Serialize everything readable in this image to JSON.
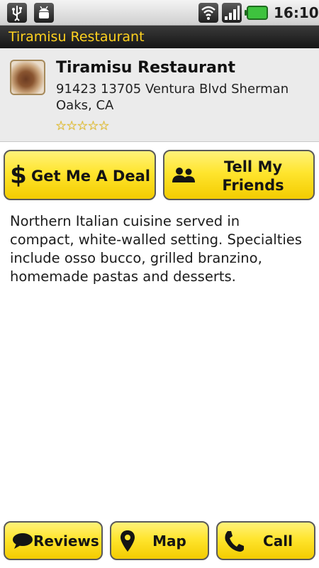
{
  "status_bar": {
    "time": "16:10",
    "icons": [
      "usb-icon",
      "android-debug-icon",
      "wifi-icon",
      "signal-icon",
      "battery-icon"
    ],
    "battery_color": "#3ec23e"
  },
  "title_bar": {
    "title": "Tiramisu Restaurant",
    "title_color": "#ffd21f"
  },
  "restaurant": {
    "name": "Tiramisu Restaurant",
    "address": "91423 13705 Ventura Blvd Sherman Oaks, CA",
    "rating_stars": 5,
    "rating_filled": 0
  },
  "actions": {
    "deal_label": "Get Me A Deal",
    "deal_icon": "dollar-icon",
    "friends_label": "Tell My Friends",
    "friends_icon": "people-icon"
  },
  "description": "Northern Italian cuisine served in compact, white-walled setting. Specialties include osso bucco, grilled branzino, homemade pastas and desserts.",
  "bottom_bar": {
    "reviews_label": "Reviews",
    "reviews_icon": "speech-bubble-icon",
    "map_label": "Map",
    "map_icon": "map-pin-icon",
    "call_label": "Call",
    "call_icon": "phone-icon"
  },
  "colors": {
    "button_yellow": "#ffe52e",
    "button_border": "#5a5a5a",
    "header_bg": "#ebebeb"
  }
}
